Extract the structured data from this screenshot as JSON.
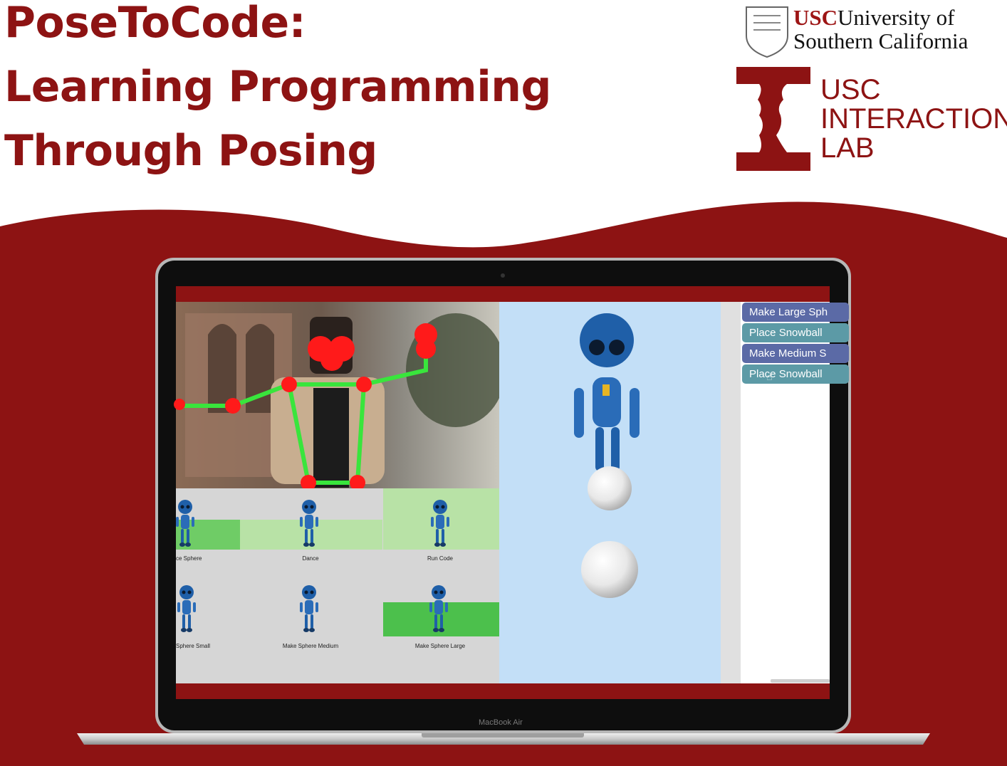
{
  "title": {
    "line1": "PoseToCode:",
    "line2": "Learning Programming",
    "line3": "Through Posing"
  },
  "logos": {
    "usc_mark": "USC",
    "usc_rest": "University of",
    "usc_line2": "Southern California",
    "lab_line1": "USC",
    "lab_line2": "INTERACTION",
    "lab_line3": "LAB"
  },
  "laptop": {
    "brand": "MacBook Air"
  },
  "pose_grid": {
    "items": [
      {
        "label": "ce Sphere"
      },
      {
        "label": "Dance"
      },
      {
        "label": "Run Code"
      },
      {
        "label": "Sphere Small"
      },
      {
        "label": "Make Sphere Medium"
      },
      {
        "label": "Make Sphere Large"
      }
    ]
  },
  "code_blocks": [
    {
      "label": "Make Large Sph"
    },
    {
      "label": "Place Snowball"
    },
    {
      "label": "Make Medium S"
    },
    {
      "label": "Place Snowball"
    }
  ],
  "colors": {
    "brand_red": "#8d1313",
    "pose_highlight": "#4cc04c",
    "pose_light": "#b8e2a6",
    "stage_blue": "#c3dff7",
    "block_purple": "#5b6aa6",
    "block_teal": "#5c9aa6"
  },
  "icons": [
    "usc-seal-icon",
    "interaction-lab-logo",
    "hand-cursor-icon",
    "robot-figure",
    "snowball-sphere",
    "pose-skeleton"
  ]
}
